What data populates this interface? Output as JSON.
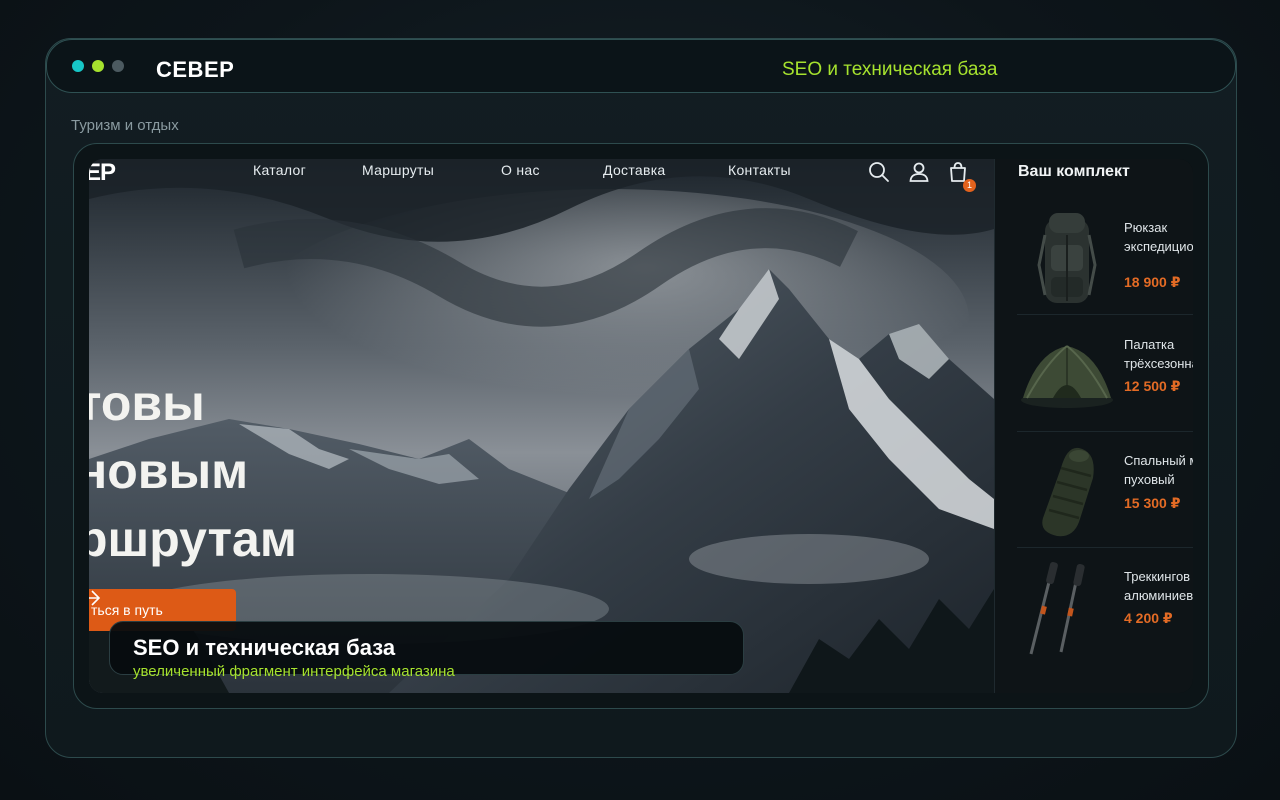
{
  "window": {
    "brand": "СЕВЕР",
    "subtitle": "SEO и техническая база",
    "dots": [
      "#17c7c7",
      "#a6e22e",
      "#4c5a60"
    ]
  },
  "category": "Туризм и отдых",
  "site": {
    "logo_fragment": "ЕР",
    "nav": [
      "Каталог",
      "Маршруты",
      "О нас",
      "Доставка",
      "Контакты"
    ],
    "icons": [
      "search-icon",
      "user-icon",
      "cart-icon"
    ],
    "cart_count": "1",
    "hero": {
      "headline_lines": [
        "товы",
        "новым",
        "ршрутам"
      ],
      "cta_label": "ться в путь",
      "accent": "#dd5a16"
    },
    "panel": {
      "title": "Ваш комплект",
      "products": [
        {
          "name_line1": "Рюкзак",
          "name_line2": "экспедицион",
          "price": "18 900 ₽"
        },
        {
          "name_line1": "Палатка",
          "name_line2": "трёхсезонна",
          "price": "12 500 ₽"
        },
        {
          "name_line1": "Спальный м",
          "name_line2": "пуховый",
          "price": "15 300 ₽"
        },
        {
          "name_line1": "Треккингов",
          "name_line2": "алюминиев",
          "price": "4 200 ₽"
        }
      ]
    }
  },
  "caption": {
    "title": "SEO и техническая база",
    "subtitle": "увеличенный фрагмент интерфейса магазина"
  }
}
